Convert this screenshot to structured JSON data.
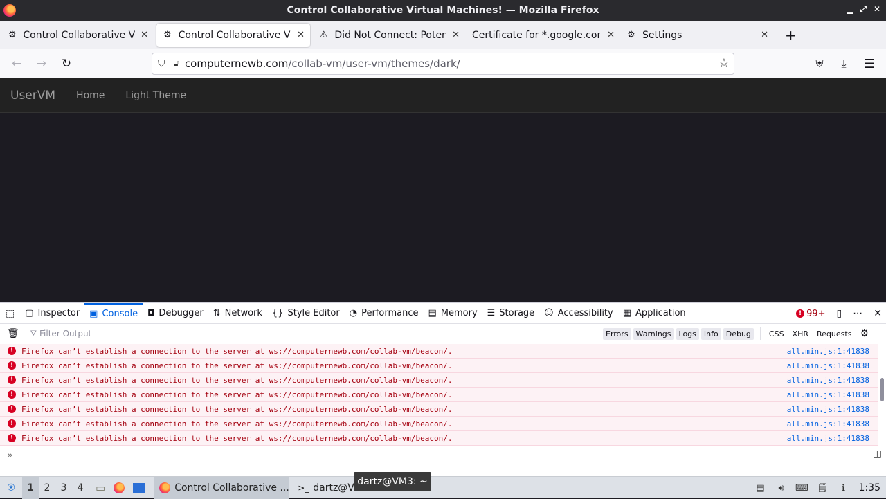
{
  "window": {
    "title": "Control Collaborative Virtual Machines! — Mozilla Firefox"
  },
  "tabs": [
    {
      "label": "Control Collaborative Virtual Machines!",
      "icon": "vm-favicon-icon",
      "active": false
    },
    {
      "label": "Control Collaborative Virtual Machines!",
      "icon": "vm-favicon-icon",
      "active": true
    },
    {
      "label": "Did Not Connect: Potential Security Issue",
      "icon": "warning-icon",
      "active": false
    },
    {
      "label": "Certificate for *.google.com",
      "icon": "",
      "active": false
    },
    {
      "label": "Settings",
      "icon": "gear-icon",
      "active": false
    }
  ],
  "url": {
    "domain": "computernewb.com",
    "path": "/collab-vm/user-vm/themes/dark/"
  },
  "site": {
    "brand": "UserVM",
    "links": [
      "Home",
      "Light Theme"
    ]
  },
  "devtools": {
    "tabs": [
      "Inspector",
      "Console",
      "Debugger",
      "Network",
      "Style Editor",
      "Performance",
      "Memory",
      "Storage",
      "Accessibility",
      "Application"
    ],
    "error_count": "99+",
    "filter_placeholder": "Filter Output",
    "levels": [
      "Errors",
      "Warnings",
      "Logs",
      "Info",
      "Debug"
    ],
    "extra_filters": [
      "CSS",
      "XHR",
      "Requests"
    ],
    "messages": [
      {
        "text": "Firefox can’t establish a connection to the server at ws://computernewb.com/collab-vm/beacon/.",
        "source": "all.min.js:1:41838"
      },
      {
        "text": "Firefox can’t establish a connection to the server at ws://computernewb.com/collab-vm/beacon/.",
        "source": "all.min.js:1:41838"
      },
      {
        "text": "Firefox can’t establish a connection to the server at ws://computernewb.com/collab-vm/beacon/.",
        "source": "all.min.js:1:41838"
      },
      {
        "text": "Firefox can’t establish a connection to the server at ws://computernewb.com/collab-vm/beacon/.",
        "source": "all.min.js:1:41838"
      },
      {
        "text": "Firefox can’t establish a connection to the server at ws://computernewb.com/collab-vm/beacon/.",
        "source": "all.min.js:1:41838"
      },
      {
        "text": "Firefox can’t establish a connection to the server at ws://computernewb.com/collab-vm/beacon/.",
        "source": "all.min.js:1:41838"
      },
      {
        "text": "Firefox can’t establish a connection to the server at ws://computernewb.com/collab-vm/beacon/.",
        "source": "all.min.js:1:41838"
      }
    ]
  },
  "taskbar": {
    "workspaces": [
      "1",
      "2",
      "3",
      "4"
    ],
    "tasks": [
      "Control Collaborative ...",
      "dartz@VM3: ~"
    ],
    "tooltip": "dartz@VM3: ~",
    "clock": "1:35"
  }
}
